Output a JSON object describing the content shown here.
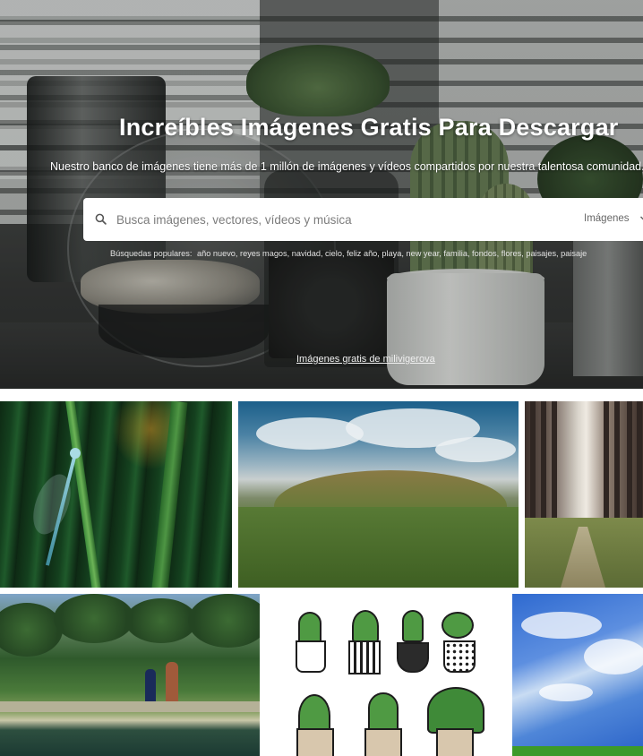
{
  "hero": {
    "title": "Increíbles Imágenes Gratis Para Descargar",
    "subtitle": "Nuestro banco de imágenes tiene más de 1 millón de imágenes y vídeos compartidos por nuestra talentosa comunidad.",
    "search": {
      "placeholder": "Busca imágenes, vectores, vídeos y música",
      "type_selected": "Imágenes"
    },
    "popular_label": "Búsquedas populares:",
    "popular_searches": [
      "año nuevo",
      "reyes magos",
      "navidad",
      "cielo",
      "feliz año",
      "playa",
      "new year",
      "familia",
      "fondos",
      "flores",
      "paisajes",
      "paisaje"
    ],
    "credit": "Imágenes gratis de milivigerova"
  },
  "gallery": {
    "tiles": [
      "dragonfly-in-grass",
      "green-hill-landscape",
      "forest-path",
      "oasis-palms",
      "cactus-illustrations",
      "blue-sky-clouds"
    ]
  }
}
